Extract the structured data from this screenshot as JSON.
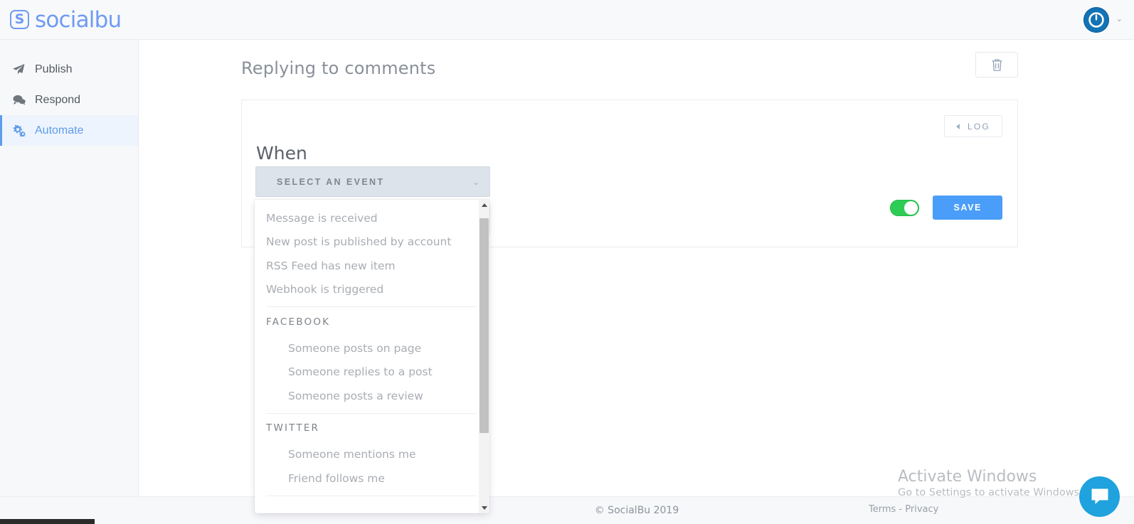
{
  "topbar": {
    "brand_mark": "S",
    "brand_name": "socialbu",
    "avatar_icon": "power-avatar-icon",
    "caret_icon": "chevron-down-icon",
    "caret_glyph": "⌄"
  },
  "sidebar": {
    "items": [
      {
        "label": "Publish",
        "icon": "paper-plane-icon",
        "active": false
      },
      {
        "label": "Respond",
        "icon": "comments-icon",
        "active": false
      },
      {
        "label": "Automate",
        "icon": "cogs-icon",
        "active": true
      }
    ]
  },
  "page": {
    "title": "Replying to comments",
    "delete_icon": "trash-icon"
  },
  "card": {
    "log_label": "LOG",
    "log_icon": "triangle-left-icon",
    "when_label": "When",
    "select": {
      "value": "SELECT AN EVENT",
      "caret_glyph": "⌄"
    },
    "toggle_state": "on",
    "save_label": "SAVE"
  },
  "dropdown": {
    "sections": [
      {
        "group": null,
        "items": [
          "Message is received",
          "New post is published by account",
          "RSS Feed has new item",
          "Webhook is triggered"
        ]
      },
      {
        "group": "FACEBOOK",
        "items": [
          "Someone posts on page",
          "Someone replies to a post",
          "Someone posts a review"
        ]
      },
      {
        "group": "TWITTER",
        "items": [
          "Someone mentions me",
          "Friend follows me"
        ]
      }
    ],
    "scroll_up_icon": "triangle-up-icon",
    "scroll_down_icon": "triangle-down-icon"
  },
  "footer": {
    "copyright": "© SocialBu 2019"
  },
  "watermark": {
    "title": "Activate Windows",
    "subtitle": "Go to Settings to activate Windows."
  },
  "terms": {
    "terms_label": "Terms",
    "separator": " - ",
    "privacy_label": "Privacy"
  },
  "chat": {
    "icon": "chat-bubble-icon"
  },
  "colors": {
    "brand": "#6f9bf2",
    "accent_blue": "#4a9df8",
    "active_nav": "#5d9cec",
    "toggle_on": "#2ecc55",
    "select_bg": "#dde3ea",
    "chat_fab": "#1fa2dd",
    "avatar": "#1273b5"
  }
}
